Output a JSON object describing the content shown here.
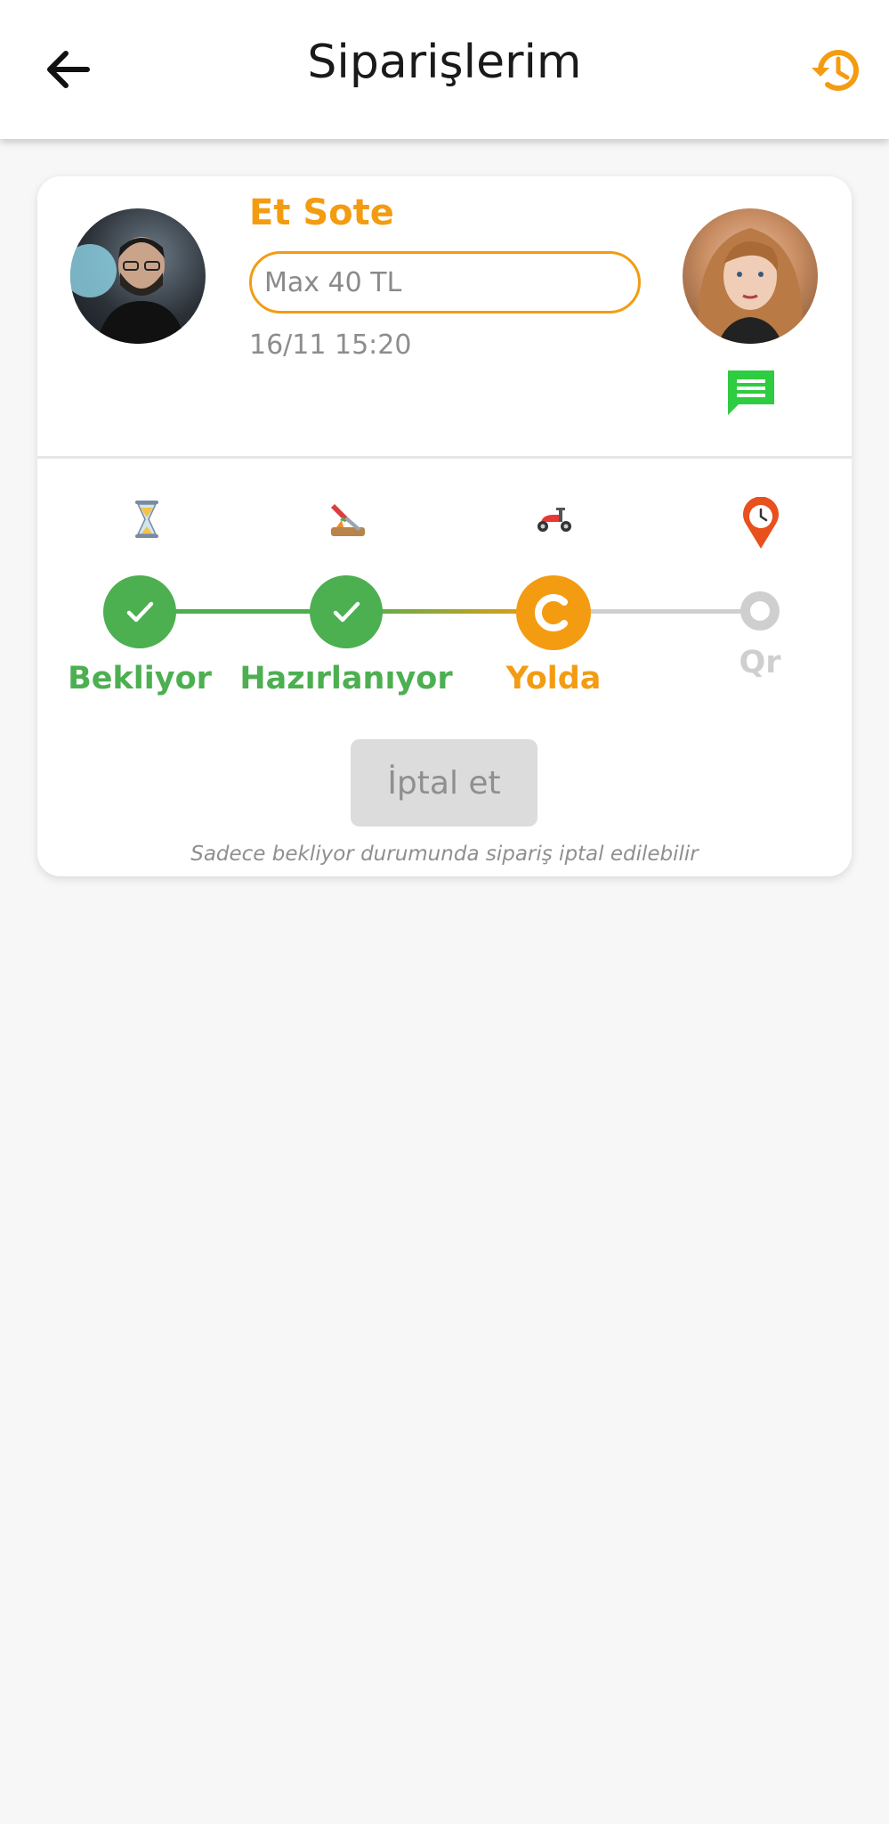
{
  "header": {
    "title": "Siparişlerim"
  },
  "order": {
    "shop_name": "Et Sote",
    "price_placeholder": "Max 40 TL",
    "datetime": "16/11 15:20",
    "steps": [
      {
        "label": "Bekliyor",
        "state": "done"
      },
      {
        "label": "Hazırlanıyor",
        "state": "done"
      },
      {
        "label": "Yolda",
        "state": "active"
      },
      {
        "label": "Qr",
        "state": "pending"
      }
    ],
    "cancel_label": "İptal et",
    "cancel_hint": "Sadece bekliyor durumunda sipariş iptal edilebilir"
  },
  "colors": {
    "accent": "#f39c12",
    "done": "#4caf50",
    "pending": "#cfcfcf",
    "chat": "#2ecc40"
  },
  "icons": {
    "back": "arrow-left-icon",
    "history": "history-icon",
    "chat": "chat-bubble-icon",
    "step1": "hourglass-icon",
    "step2": "cutting-board-icon",
    "step3": "scooter-icon",
    "step4": "map-pin-clock-icon"
  }
}
